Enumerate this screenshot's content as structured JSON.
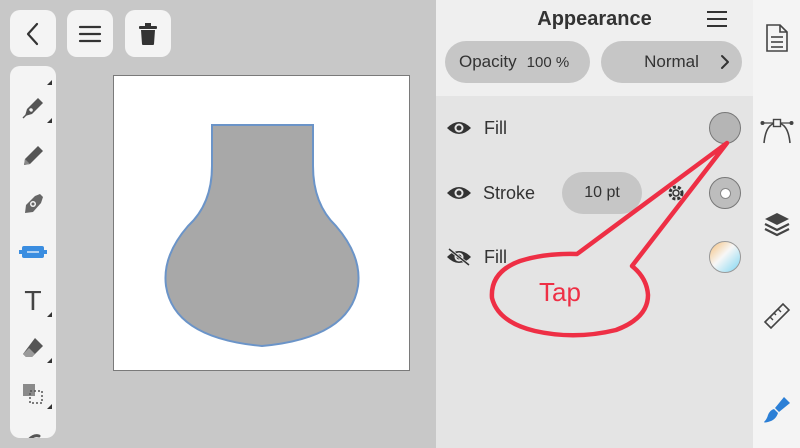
{
  "top_bar": {
    "back_icon": "chevron-left-icon",
    "menu_icon": "hamburger-icon",
    "delete_icon": "trash-icon"
  },
  "tools": [
    "pen-tool-icon",
    "pencil-icon",
    "vector-brush-icon",
    "shape-tool-icon",
    "text-tool-icon",
    "eraser-icon",
    "transform-icon"
  ],
  "tools_text": {
    "text_tool_glyph": "T"
  },
  "canvas": {
    "shape_fill": "#a8a8a8",
    "shape_stroke": "#6b94c8"
  },
  "panel": {
    "title": "Appearance",
    "opacity_label": "Opacity",
    "opacity_value": "100 %",
    "blend_mode": "Normal",
    "rows": [
      {
        "label": "Fill",
        "visible": true,
        "swatch": "#b5b5b5"
      },
      {
        "label": "Stroke",
        "visible": true,
        "value": "10 pt"
      },
      {
        "label": "Fill",
        "visible": false
      }
    ]
  },
  "right_bar": [
    "document-icon",
    "bezier-path-icon",
    "layers-icon",
    "ruler-icon",
    "brush-icon"
  ],
  "annotation": {
    "text": "Tap",
    "color": "#ee2f45"
  }
}
